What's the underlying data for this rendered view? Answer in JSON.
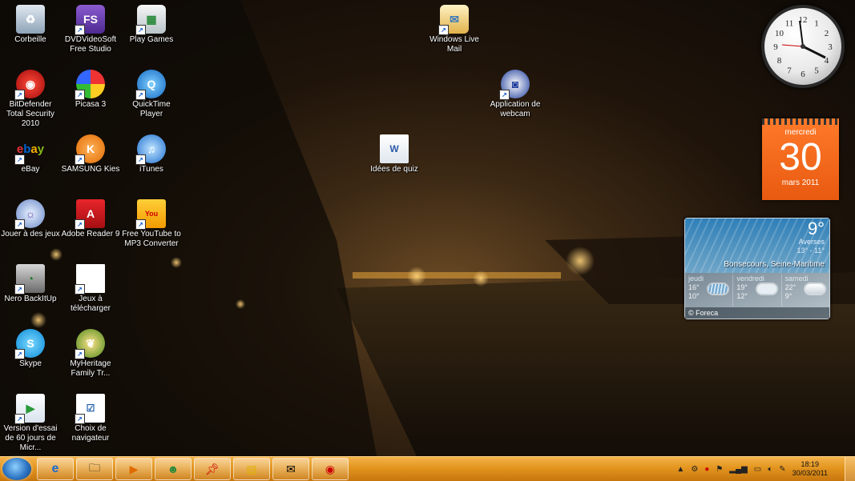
{
  "desktop": {
    "icons": [
      {
        "id": "corbeille",
        "label": "Corbeille",
        "icon": "recycle-bin-icon",
        "shortcut": false
      },
      {
        "id": "dvdvideosoft",
        "label": "DVDVideoSoft Free Studio",
        "icon": "fs-icon",
        "shortcut": true
      },
      {
        "id": "play-games",
        "label": "Play Games",
        "icon": "games-icon",
        "shortcut": true
      },
      {
        "id": "windows-live-mail",
        "label": "Windows Live Mail",
        "icon": "mail-icon",
        "shortcut": true
      },
      {
        "id": "bitdefender",
        "label": "BitDefender Total Security 2010",
        "icon": "bitdefender-icon",
        "shortcut": true
      },
      {
        "id": "picasa",
        "label": "Picasa 3",
        "icon": "picasa-icon",
        "shortcut": true
      },
      {
        "id": "quicktime",
        "label": "QuickTime Player",
        "icon": "quicktime-icon",
        "shortcut": true
      },
      {
        "id": "webcam",
        "label": "Application de webcam",
        "icon": "webcam-icon",
        "shortcut": true
      },
      {
        "id": "ebay",
        "label": "eBay",
        "icon": "ebay-icon",
        "shortcut": true
      },
      {
        "id": "samsung-kies",
        "label": "SAMSUNG Kies",
        "icon": "kies-icon",
        "shortcut": true
      },
      {
        "id": "itunes",
        "label": "iTunes",
        "icon": "itunes-icon",
        "shortcut": true
      },
      {
        "id": "idees-quiz",
        "label": "Idées de quiz",
        "icon": "document-icon",
        "shortcut": false
      },
      {
        "id": "jouer-jeux",
        "label": "Jouer à des jeux",
        "icon": "games-orb-icon",
        "shortcut": true
      },
      {
        "id": "adobe-reader",
        "label": "Adobe Reader 9",
        "icon": "adobe-reader-icon",
        "shortcut": true
      },
      {
        "id": "youtube-mp3",
        "label": "Free YouTube to MP3 Converter",
        "icon": "youtube-icon",
        "shortcut": true
      },
      {
        "id": "nero",
        "label": "Nero BackItUp",
        "icon": "nero-icon",
        "shortcut": true
      },
      {
        "id": "jeux-telecharger",
        "label": "Jeux à télécharger",
        "icon": "blank-file-icon",
        "shortcut": true
      },
      {
        "id": "skype",
        "label": "Skype",
        "icon": "skype-icon",
        "shortcut": true
      },
      {
        "id": "myheritage",
        "label": "MyHeritage Family Tr...",
        "icon": "myheritage-icon",
        "shortcut": true
      },
      {
        "id": "office-trial",
        "label": "Version d'essai de 60 jours de Micr...",
        "icon": "office-icon",
        "shortcut": true
      },
      {
        "id": "browser-choice",
        "label": "Choix de navigateur",
        "icon": "checklist-icon",
        "shortcut": true
      }
    ]
  },
  "gadgets": {
    "clock": {
      "numerals": [
        "12",
        "1",
        "2",
        "3",
        "4",
        "5",
        "6",
        "7",
        "8",
        "9",
        "10",
        "11"
      ]
    },
    "calendar": {
      "weekday": "mercredi",
      "day": "30",
      "month_year": "mars 2011"
    },
    "weather": {
      "temp": "9°",
      "condition": "Averses",
      "hilo": "13° - 11°",
      "location": "Bonsecours, Seine-Maritime",
      "forecast": [
        {
          "day": "jeudi",
          "high": "16°",
          "low": "10°"
        },
        {
          "day": "vendredi",
          "high": "19°",
          "low": "12°"
        },
        {
          "day": "samedi",
          "high": "22°",
          "low": "9°"
        }
      ],
      "credit": "© Foreca"
    }
  },
  "taskbar": {
    "pinned": [
      "internet-explorer-icon",
      "explorer-folder-icon",
      "media-player-icon",
      "messenger-icon",
      "pushpin-icon",
      "sticky-notes-icon",
      "mail-icon",
      "bitdefender-icon"
    ],
    "time": "18:19",
    "date": "30/03/2011"
  }
}
